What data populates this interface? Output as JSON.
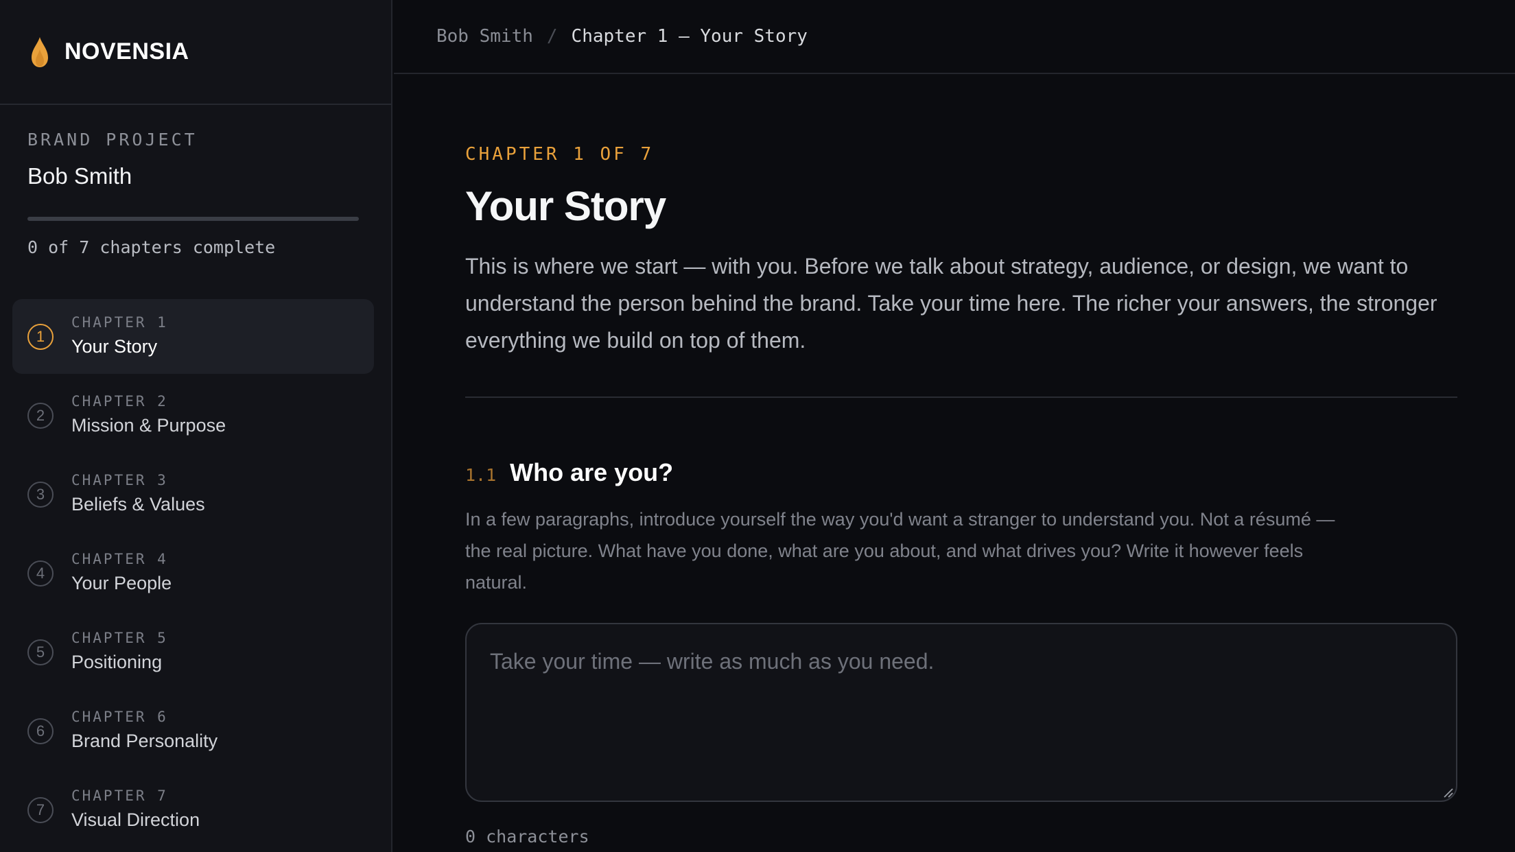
{
  "brand": {
    "name": "NOVENSIA",
    "accent": "#e9a13b"
  },
  "project": {
    "label": "BRAND PROJECT",
    "name": "Bob Smith",
    "progress_fraction": 0,
    "progress_text": "0 of 7 chapters complete"
  },
  "chapters": [
    {
      "num": "1",
      "label": "CHAPTER 1",
      "title": "Your Story",
      "active": true
    },
    {
      "num": "2",
      "label": "CHAPTER 2",
      "title": "Mission & Purpose",
      "active": false
    },
    {
      "num": "3",
      "label": "CHAPTER 3",
      "title": "Beliefs & Values",
      "active": false
    },
    {
      "num": "4",
      "label": "CHAPTER 4",
      "title": "Your People",
      "active": false
    },
    {
      "num": "5",
      "label": "CHAPTER 5",
      "title": "Positioning",
      "active": false
    },
    {
      "num": "6",
      "label": "CHAPTER 6",
      "title": "Brand Personality",
      "active": false
    },
    {
      "num": "7",
      "label": "CHAPTER 7",
      "title": "Visual Direction",
      "active": false
    }
  ],
  "breadcrumb": {
    "root": "Bob Smith",
    "separator": "/",
    "current": "Chapter 1 — Your Story"
  },
  "main": {
    "kicker": "CHAPTER 1 OF 7",
    "title": "Your Story",
    "intro": "This is where we start — with you. Before we talk about strategy, audience, or design, we want to understand the person behind the brand. Take your time here. The richer your answers, the stronger everything we build on top of them.",
    "question": {
      "number": "1.1",
      "title": "Who are you?",
      "description": "In a few paragraphs, introduce yourself the way you'd want a stranger to understand you. Not a résumé — the real picture. What have you done, what are you about, and what drives you? Write it however feels natural.",
      "placeholder": "Take your time — write as much as you need.",
      "value": "",
      "char_count": "0 characters"
    }
  }
}
